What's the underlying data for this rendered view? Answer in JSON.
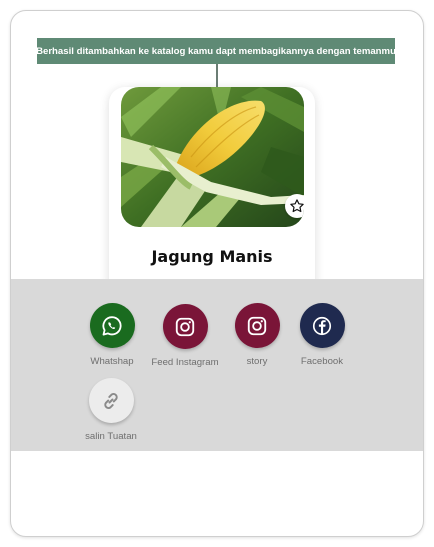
{
  "toast": {
    "message": "Berhasil ditambahkan ke katalog kamu dapt membagikannya dengan temanmu",
    "background": "#5f8a75"
  },
  "product": {
    "name": "Jagung Manis",
    "image": "sweet-corn-photo",
    "favorite_icon": "star-outline-icon"
  },
  "share": {
    "panel_background": "#d9d9d9",
    "options": [
      {
        "label": "Whatshap",
        "icon": "whatsapp-icon",
        "color": "#1a6b1f"
      },
      {
        "label": "Feed Instagram",
        "icon": "instagram-icon",
        "color": "#7a1538"
      },
      {
        "label": "story",
        "icon": "instagram-icon",
        "color": "#7a1538"
      },
      {
        "label": "Facebook",
        "icon": "facebook-icon",
        "color": "#1f2a4f"
      },
      {
        "label": "salin Tuatan",
        "icon": "link-icon",
        "color": "#ececec"
      }
    ]
  }
}
